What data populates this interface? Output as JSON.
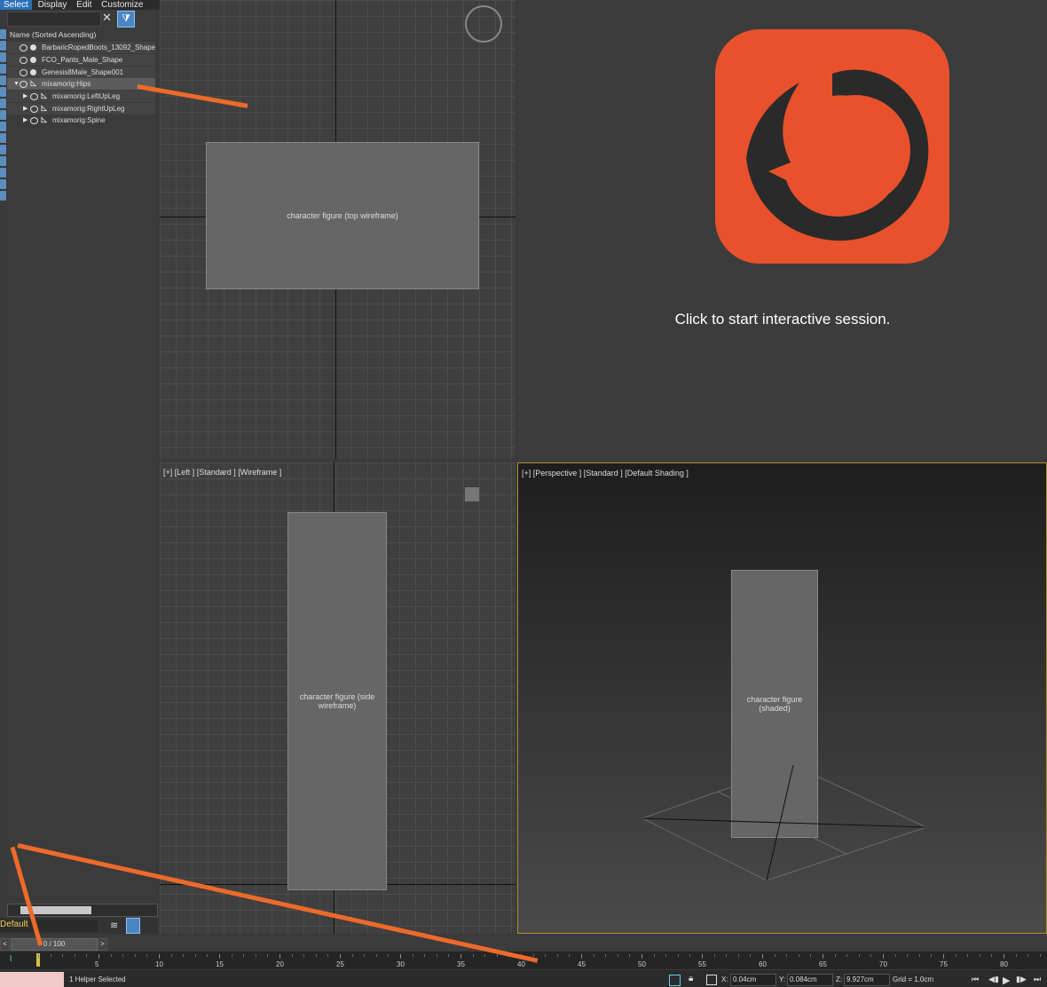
{
  "menu": {
    "items": [
      "Select",
      "Display",
      "Edit",
      "Customize"
    ]
  },
  "explorer": {
    "column_header": "Name (Sorted Ascending)",
    "rows": [
      {
        "label": "BarbaricRopedBoots_13092_Shape"
      },
      {
        "label": "FCO_Pants_Male_Shape"
      },
      {
        "label": "Genesis8Male_Shape001"
      },
      {
        "label": "mixamorig:Hips"
      },
      {
        "label": "mixamorig:LeftUpLeg"
      },
      {
        "label": "mixamorig:RightUpLeg"
      },
      {
        "label": "mixamorig:Spine"
      }
    ]
  },
  "layer": {
    "name": "Default"
  },
  "viewports": {
    "left": {
      "label": "[+] [Left ] [Standard ] [Wireframe ]"
    },
    "perspective": {
      "label": "[+] [Perspective ] [Standard ] [Default Shading ]"
    },
    "corona": {
      "message": "Click to start interactive session."
    }
  },
  "timeline": {
    "slider": "0 / 100",
    "ticks": [
      "5",
      "10",
      "15",
      "20",
      "25",
      "30",
      "35",
      "40",
      "45",
      "50",
      "55",
      "60",
      "65",
      "70",
      "75",
      "80"
    ]
  },
  "status": {
    "selection": "1 Helper Selected",
    "x_label": "X:",
    "x_value": "0.04cm",
    "y_label": "Y:",
    "y_value": "0.084cm",
    "z_label": "Z:",
    "z_value": "9.927cm",
    "grid": "Grid = 1.0cm"
  },
  "colors": {
    "accent": "#e8512c",
    "selection": "#2a6fb8",
    "arrow": "#ee6a2a",
    "layer_text": "#f3d34a"
  },
  "icons": [
    "eye-icon",
    "bone-icon",
    "filter-icon",
    "clear-icon",
    "layers-icon",
    "play-icon",
    "lock-icon"
  ]
}
